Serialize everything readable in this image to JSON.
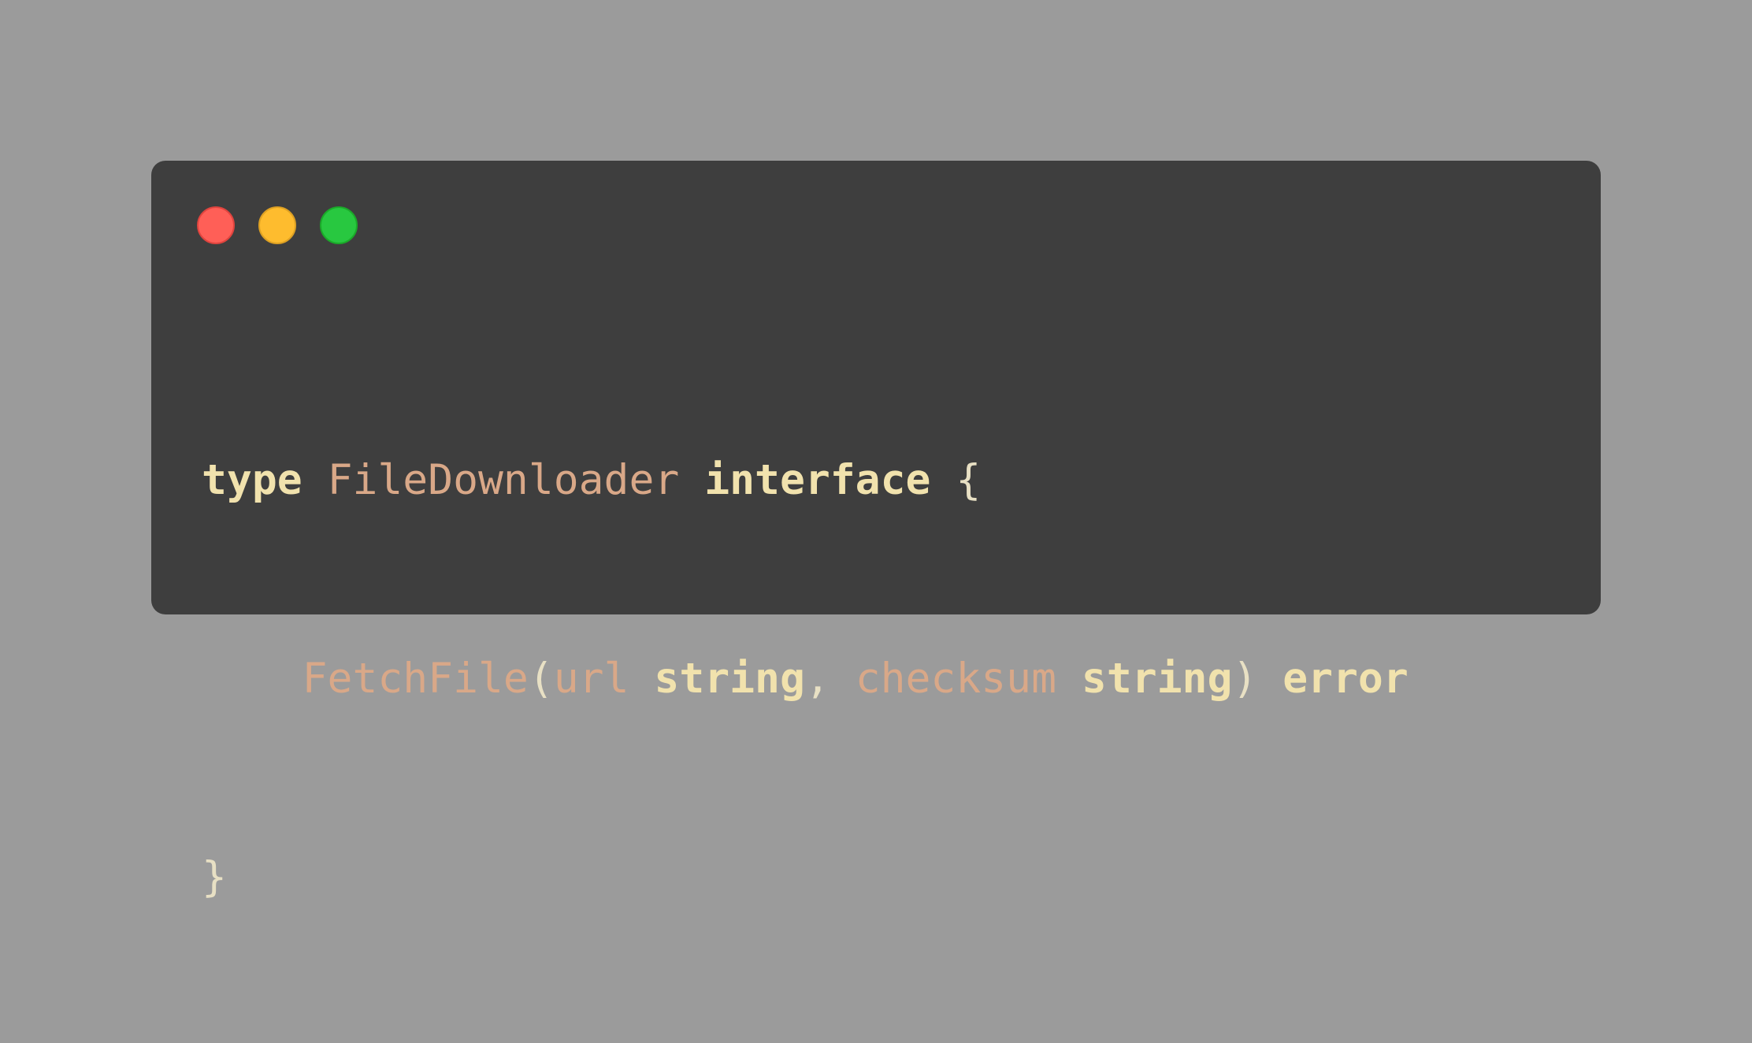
{
  "window": {
    "controls": {
      "close": "close-control",
      "minimize": "minimize-control",
      "maximize": "maximize-control",
      "colors": {
        "close": "#ff5f57",
        "minimize": "#febc2e",
        "maximize": "#28c840"
      }
    },
    "background": "#3e3e3e"
  },
  "page_background": "#9b9b9b",
  "code": {
    "language": "go",
    "line1": {
      "kw_type": "type",
      "name": "FileDownloader",
      "kw_interface": "interface",
      "brace_open": "{"
    },
    "line2": {
      "indent": "    ",
      "method": "FetchFile",
      "paren_open": "(",
      "param1": "url",
      "type1": "string",
      "comma": ",",
      "param2": "checksum",
      "type2": "string",
      "paren_close": ")",
      "ret": "error"
    },
    "line3": {
      "brace_close": "}"
    },
    "colors": {
      "keyword": "#f1e2ad",
      "identifier": "#d9a888",
      "punctuation": "#e8e0c4"
    }
  }
}
